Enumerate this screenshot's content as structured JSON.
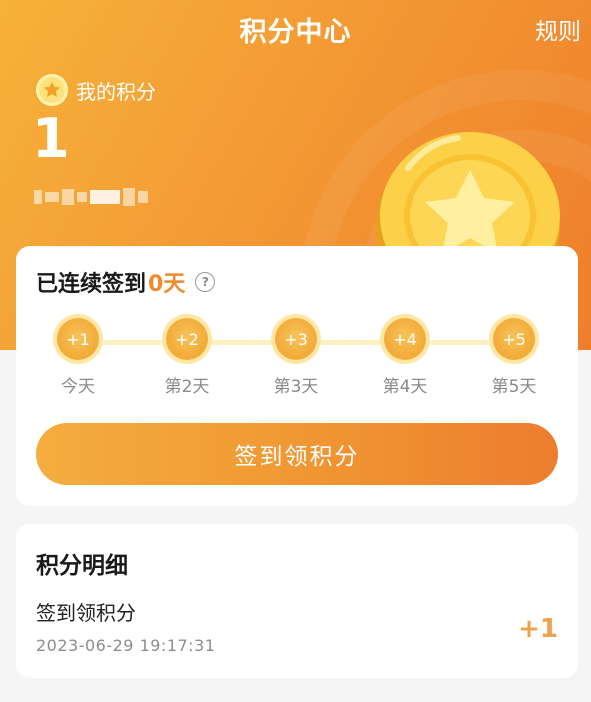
{
  "header": {
    "title": "积分中心",
    "rules_label": "规则"
  },
  "account": {
    "my_points_label": "我的积分",
    "points": "1"
  },
  "checkin": {
    "heading_prefix": "已连续签到",
    "streak": "0天",
    "days": [
      {
        "reward": "+1",
        "label": "今天"
      },
      {
        "reward": "+2",
        "label": "第2天"
      },
      {
        "reward": "+3",
        "label": "第3天"
      },
      {
        "reward": "+4",
        "label": "第4天"
      },
      {
        "reward": "+5",
        "label": "第5天"
      }
    ],
    "button_label": "签到领积分"
  },
  "details": {
    "title": "积分明细",
    "records": [
      {
        "name": "签到领积分",
        "time": "2023-06-29 19:17:31",
        "points": "+1"
      }
    ]
  },
  "colors": {
    "brand_orange": "#f09833",
    "streak_accent": "#f08a2c",
    "points_accent": "#f0a24a"
  },
  "icons": {
    "points_badge": "star-icon",
    "help": "question-circle-icon",
    "hero_illustration": "gold-coin-star"
  }
}
